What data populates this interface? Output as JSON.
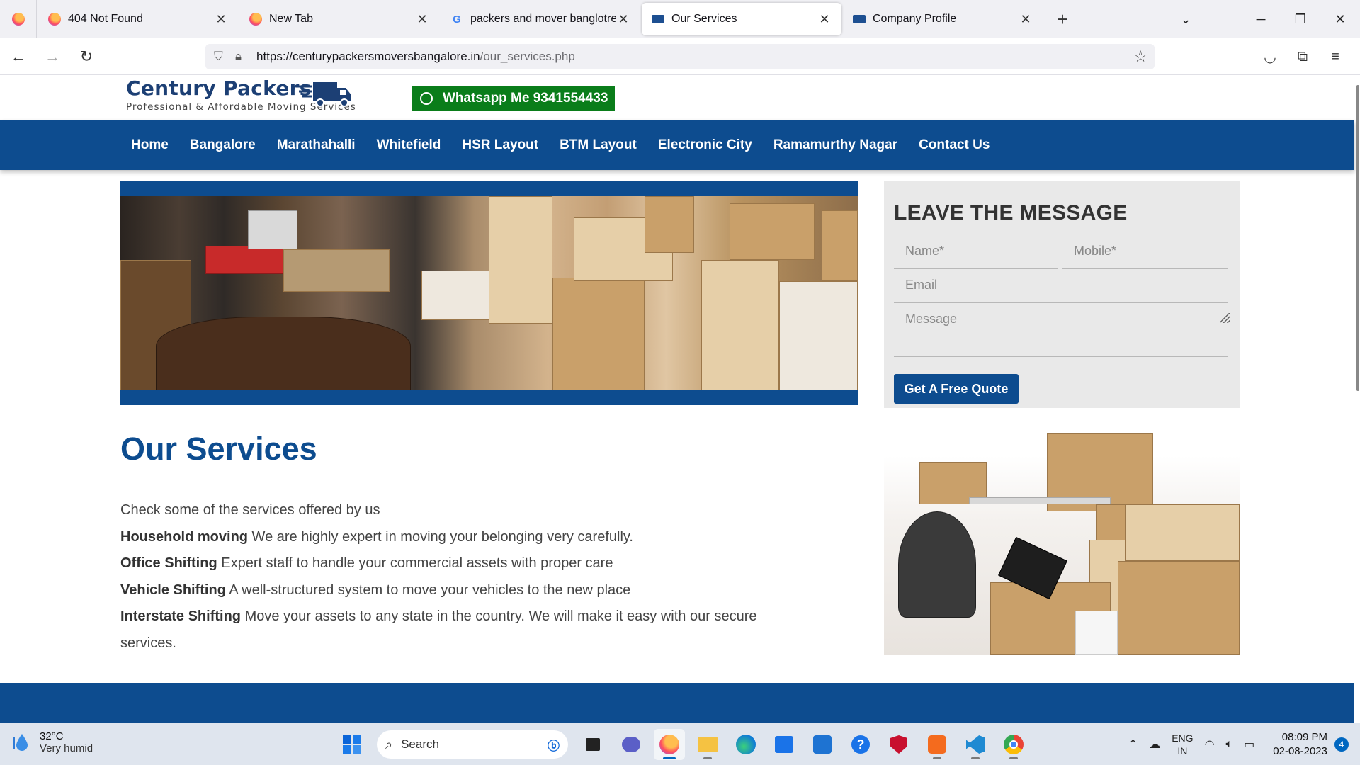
{
  "browser": {
    "tabs": [
      {
        "title": "404 Not Found",
        "icon": "firefox-icon"
      },
      {
        "title": "New Tab",
        "icon": "firefox-icon"
      },
      {
        "title": "packers and mover banglotre c",
        "icon": "google-icon"
      },
      {
        "title": "Our Services",
        "icon": "truck-icon",
        "active": true
      },
      {
        "title": "Company Profile",
        "icon": "truck-icon"
      }
    ],
    "url_host": "https://centurypackersmoversbangalore.in",
    "url_path": "/our_services.php"
  },
  "site": {
    "logo_name": "Century Packers",
    "logo_tagline": "Professional & Affordable Moving Services",
    "whatsapp_label": "Whatsapp Me 9341554433",
    "brand_color": "#0d4c8f",
    "whatsapp_color": "#0a7d1a",
    "nav": [
      "Home",
      "Bangalore",
      "Marathahalli",
      "Whitefield",
      "HSR Layout",
      "BTM Layout",
      "Electronic City",
      "Ramamurthy Nagar",
      "Contact Us"
    ]
  },
  "form": {
    "title": "LEAVE THE MESSAGE",
    "name_placeholder": "Name*",
    "mobile_placeholder": "Mobile*",
    "email_placeholder": "Email",
    "message_placeholder": "Message",
    "submit_label": "Get A Free Quote"
  },
  "services": {
    "heading": "Our Services",
    "intro": "Check some of the services offered by us",
    "items": [
      {
        "name": "Household moving",
        "desc": " We are highly expert in moving your belonging very carefully."
      },
      {
        "name": "Office Shifting",
        "desc": " Expert staff to handle your commercial assets with proper care"
      },
      {
        "name": "Vehicle Shifting",
        "desc": " A well-structured system to move your vehicles to the new place"
      },
      {
        "name": "Interstate Shifting",
        "desc": " Move your assets to any state in the country. We will make it easy with our secure services."
      }
    ]
  },
  "taskbar": {
    "temperature": "32°C",
    "weather_desc": "Very humid",
    "search_label": "Search",
    "lang_top": "ENG",
    "lang_bottom": "IN",
    "time": "08:09 PM",
    "date": "02-08-2023",
    "notifications": "4"
  }
}
